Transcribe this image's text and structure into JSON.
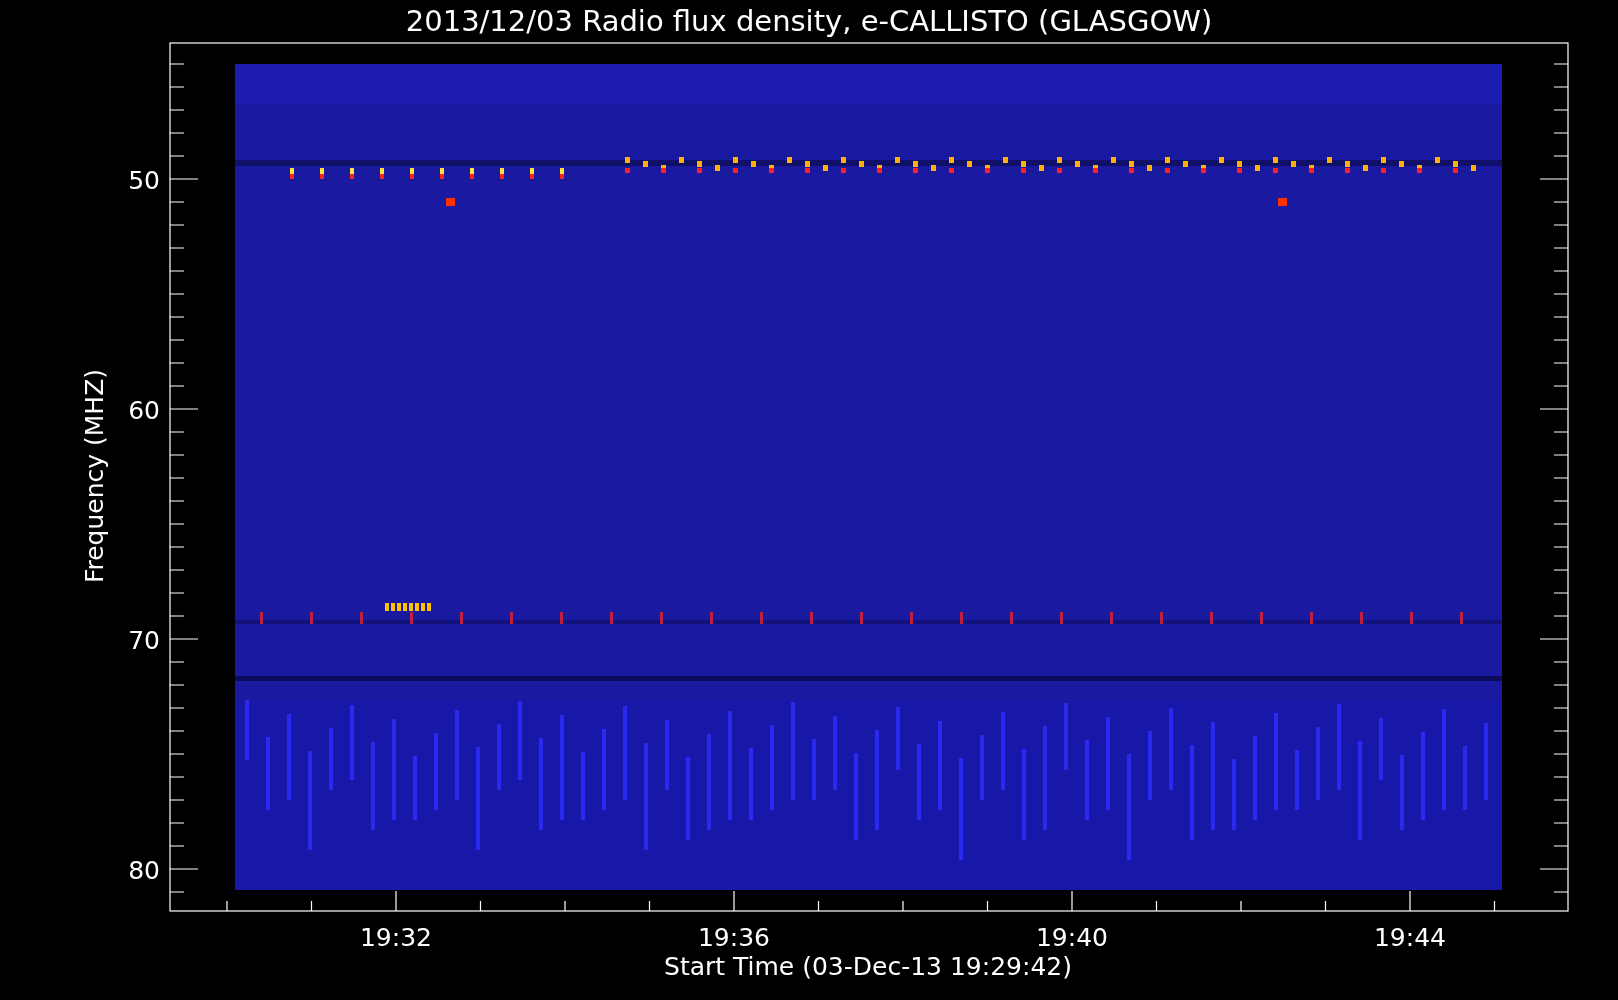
{
  "title": "2013/12/03  Radio flux density, e-CALLISTO (GLASGOW)",
  "y_axis": {
    "label": "Frequency (MHZ)",
    "ticks": [
      "50",
      "60",
      "70",
      "80"
    ]
  },
  "x_axis": {
    "label": "Start Time (03-Dec-13 19:29:42)",
    "ticks": [
      "19:32",
      "19:36",
      "19:40",
      "19:44"
    ]
  }
}
